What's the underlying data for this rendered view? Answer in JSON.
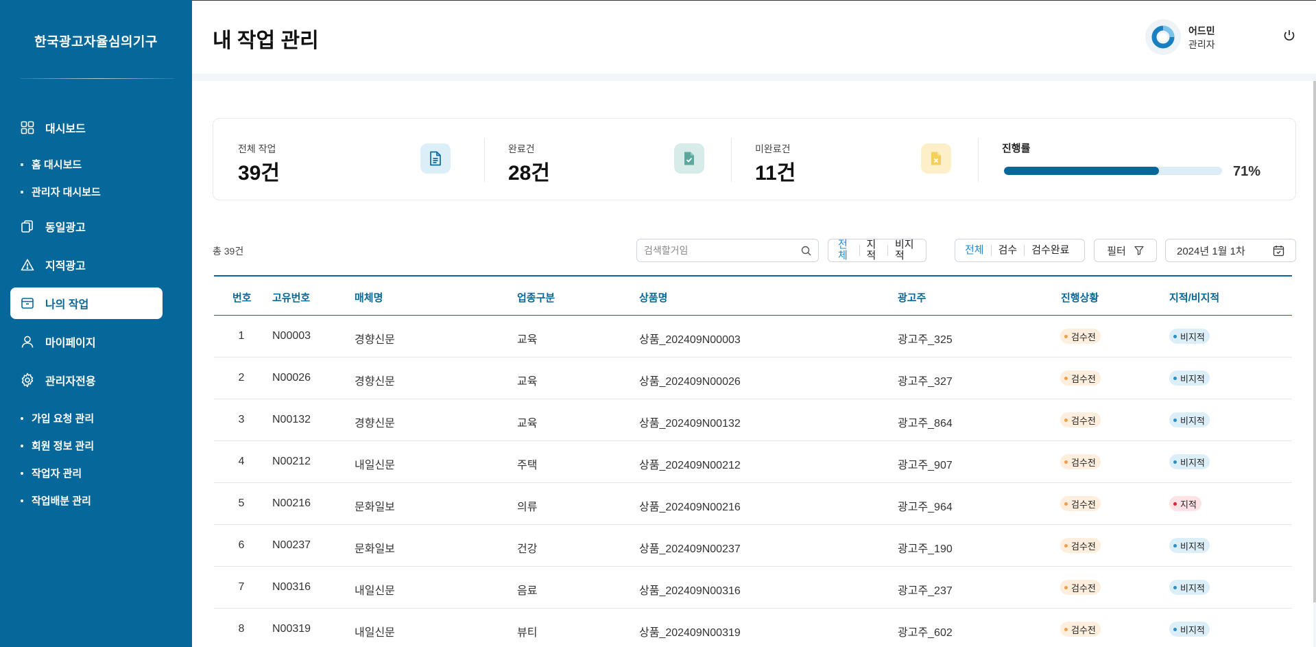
{
  "sidebar": {
    "brand": "한국광고자율심의기구",
    "nav": {
      "dashboard": "대시보드",
      "home_dashboard": "홈 대시보드",
      "admin_dashboard": "관리자 대시보드",
      "same_ads": "동일광고",
      "flagged_ads": "지적광고",
      "my_tasks": "나의 작업",
      "mypage": "마이페이지",
      "admin_only": "관리자전용",
      "signup_requests": "가입 요청 관리",
      "member_info": "회원 정보 관리",
      "worker_mgmt": "작업자 관리",
      "task_assign": "작업배분 관리"
    }
  },
  "header": {
    "title": "내 작업 관리",
    "user_name": "어드민",
    "user_role": "관리자"
  },
  "stats": {
    "total_label": "전체 작업",
    "total_value": "39건",
    "done_label": "완료건",
    "done_value": "28건",
    "undone_label": "미완료건",
    "undone_value": "11건",
    "progress_label": "진행률",
    "progress_value": "71%",
    "progress_fraction": 0.71
  },
  "toolbar": {
    "total_count": "총 39건",
    "search_placeholder": "검색할거임",
    "seg1": [
      "전체",
      "지적",
      "비지적"
    ],
    "seg2": [
      "전체",
      "검수",
      "검수완료"
    ],
    "filter_label": "필터",
    "date_label": "2024년 1월 1차"
  },
  "table": {
    "headers": {
      "no": "번호",
      "code": "고유번호",
      "media": "매체명",
      "industry": "업종구분",
      "product": "상품명",
      "advertiser": "광고주",
      "status": "진행상황",
      "flag": "지적/비지적"
    },
    "rows": [
      {
        "no": "1",
        "code": "N00003",
        "media": "경향신문",
        "industry": "교육",
        "product": "상품_202409N00003",
        "advertiser": "광고주_325",
        "status": "검수전",
        "flag": "비지적"
      },
      {
        "no": "2",
        "code": "N00026",
        "media": "경향신문",
        "industry": "교육",
        "product": "상품_202409N00026",
        "advertiser": "광고주_327",
        "status": "검수전",
        "flag": "비지적"
      },
      {
        "no": "3",
        "code": "N00132",
        "media": "경향신문",
        "industry": "교육",
        "product": "상품_202409N00132",
        "advertiser": "광고주_864",
        "status": "검수전",
        "flag": "비지적"
      },
      {
        "no": "4",
        "code": "N00212",
        "media": "내일신문",
        "industry": "주택",
        "product": "상품_202409N00212",
        "advertiser": "광고주_907",
        "status": "검수전",
        "flag": "비지적"
      },
      {
        "no": "5",
        "code": "N00216",
        "media": "문화일보",
        "industry": "의류",
        "product": "상품_202409N00216",
        "advertiser": "광고주_964",
        "status": "검수전",
        "flag": "지적"
      },
      {
        "no": "6",
        "code": "N00237",
        "media": "문화일보",
        "industry": "건강",
        "product": "상품_202409N00237",
        "advertiser": "광고주_190",
        "status": "검수전",
        "flag": "비지적"
      },
      {
        "no": "7",
        "code": "N00316",
        "media": "내일신문",
        "industry": "음료",
        "product": "상품_202409N00316",
        "advertiser": "광고주_237",
        "status": "검수전",
        "flag": "비지적"
      },
      {
        "no": "8",
        "code": "N00319",
        "media": "내일신문",
        "industry": "뷰티",
        "product": "상품_202409N00319",
        "advertiser": "광고주_602",
        "status": "검수전",
        "flag": "비지적"
      }
    ]
  },
  "colors": {
    "primary": "#06679a",
    "accent_link": "#1d8ad3",
    "pending_badge": "#fdeedd",
    "normal_badge": "#dceef8",
    "flag_badge": "#fde2e6"
  }
}
